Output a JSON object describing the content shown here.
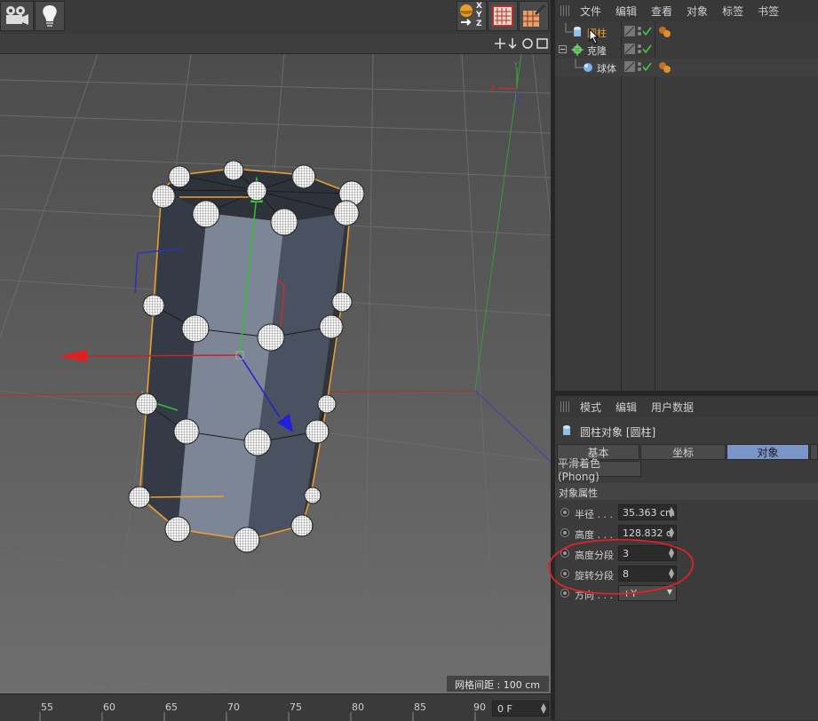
{
  "object_manager": {
    "menu": [
      "文件",
      "编辑",
      "查看",
      "对象",
      "标签",
      "书签"
    ],
    "objects": [
      {
        "name": "圆柱",
        "selected": true,
        "icon": "cylinder-icon"
      },
      {
        "name": "克隆",
        "selected": false,
        "icon": "cloner-icon"
      },
      {
        "name": "球体",
        "selected": false,
        "icon": "sphere-icon"
      }
    ]
  },
  "attribute_manager": {
    "menu": [
      "模式",
      "编辑",
      "用户数据"
    ],
    "object_title": "圆柱对象 [圆柱]",
    "tabs": [
      "基本",
      "坐标",
      "对象"
    ],
    "active_tab": "对象",
    "phong_tab": "平滑着色(Phong)",
    "section_title": "对象属性",
    "properties": [
      {
        "label": "半径 . . .",
        "value": "35.363 cm"
      },
      {
        "label": "高度 . . .",
        "value": "128.832 c"
      },
      {
        "label": "高度分段",
        "value": "3"
      },
      {
        "label": "旋转分段",
        "value": "8"
      },
      {
        "label": "方向 . . .",
        "value": "+Y"
      }
    ]
  },
  "viewport": {
    "grid_spacing": "网格间距 : 100 cm",
    "axis_labels": [
      "Y",
      "X",
      "Z"
    ]
  },
  "toolbar": {
    "coord_labels": [
      "X",
      "Y",
      "Z"
    ]
  },
  "timeline": {
    "ticks": [
      "55",
      "60",
      "65",
      "70",
      "75",
      "80",
      "85",
      "90"
    ],
    "frame_value": "0 F"
  },
  "colors": {
    "selection_orange": "#f0a030",
    "active_tab": "#7a96c8",
    "annotation_red": "#e0202a"
  }
}
